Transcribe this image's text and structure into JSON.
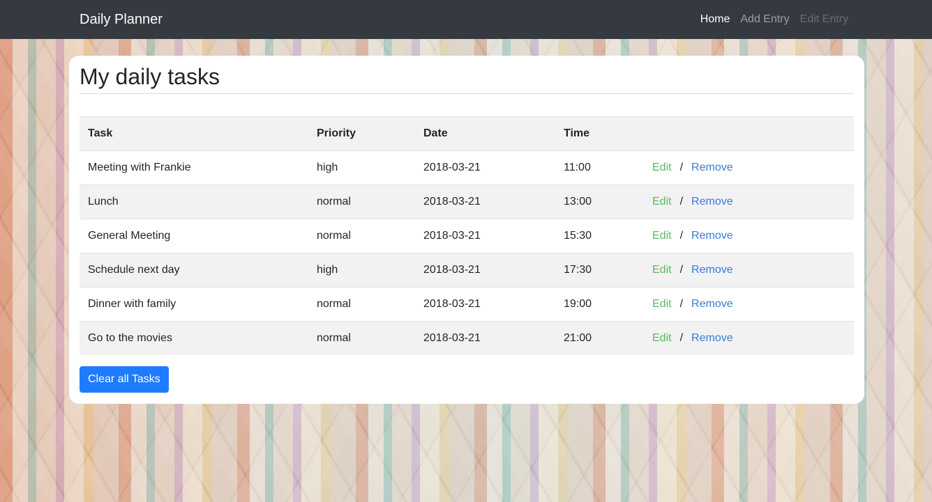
{
  "navbar": {
    "brand": "Daily Planner",
    "links": [
      {
        "label": "Home",
        "state": "active"
      },
      {
        "label": "Add Entry",
        "state": "normal"
      },
      {
        "label": "Edit Entry",
        "state": "disabled"
      }
    ]
  },
  "main": {
    "title": "My daily tasks",
    "table": {
      "headers": [
        "Task",
        "Priority",
        "Date",
        "Time",
        ""
      ],
      "rows": [
        {
          "task": "Meeting with Frankie",
          "priority": "high",
          "date": "2018-03-21",
          "time": "11:00"
        },
        {
          "task": "Lunch",
          "priority": "normal",
          "date": "2018-03-21",
          "time": "13:00"
        },
        {
          "task": "General Meeting",
          "priority": "normal",
          "date": "2018-03-21",
          "time": "15:30"
        },
        {
          "task": "Schedule next day",
          "priority": "high",
          "date": "2018-03-21",
          "time": "17:30"
        },
        {
          "task": "Dinner with family",
          "priority": "normal",
          "date": "2018-03-21",
          "time": "19:00"
        },
        {
          "task": "Go to the movies",
          "priority": "normal",
          "date": "2018-03-21",
          "time": "21:00"
        }
      ],
      "row_actions": {
        "edit": "Edit",
        "separator": "/",
        "remove": "Remove"
      }
    },
    "clear_button": "Clear all Tasks"
  },
  "colors": {
    "navbar_bg": "#343a40",
    "edit_link": "#5cb85c",
    "remove_link": "#3a7bd5",
    "primary_button": "#1e7bff"
  }
}
